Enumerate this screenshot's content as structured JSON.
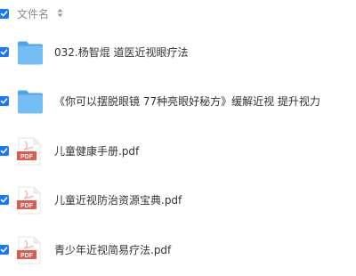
{
  "header": {
    "column_label": "文件名"
  },
  "icons": {
    "folder": "folder-icon",
    "pdf": "pdf-file-icon",
    "sort": "sort-icon",
    "check": "checkmark-icon"
  },
  "colors": {
    "checkbox": "#1677ff",
    "folder": "#75bdf5",
    "pdf": "#e05a4f",
    "text": "#333333",
    "header_text": "#8c8c8c"
  },
  "files": [
    {
      "name": "032.杨智焜 道医近视眼疗法",
      "type": "folder",
      "checked": true
    },
    {
      "name": "《你可以摆脱眼镜 77种亮眼好秘方》缓解近视 提升视力",
      "type": "folder",
      "checked": true
    },
    {
      "name": "儿童健康手册.pdf",
      "type": "pdf",
      "icon_label": "PDF",
      "checked": true
    },
    {
      "name": "儿童近视防治资源宝典.pdf",
      "type": "pdf",
      "icon_label": "PDF",
      "checked": true
    },
    {
      "name": "青少年近视简易疗法.pdf",
      "type": "pdf",
      "icon_label": "PDF",
      "checked": true
    }
  ]
}
